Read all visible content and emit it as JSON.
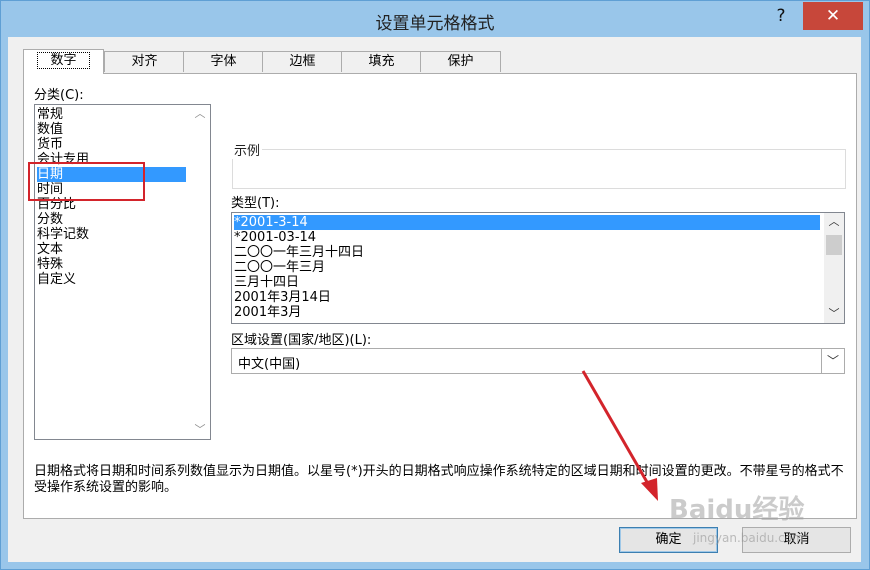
{
  "window": {
    "title": "设置单元格格式",
    "help_label": "?",
    "close_label": "✕"
  },
  "tabs": [
    "数字",
    "对齐",
    "字体",
    "边框",
    "填充",
    "保护"
  ],
  "category": {
    "label": "分类(C):",
    "items": [
      "常规",
      "数值",
      "货币",
      "会计专用",
      "日期",
      "时间",
      "百分比",
      "分数",
      "科学记数",
      "文本",
      "特殊",
      "自定义"
    ],
    "selected": "日期"
  },
  "sample": {
    "label": "示例",
    "value": ""
  },
  "type": {
    "label": "类型(T):",
    "items": [
      "*2001-3-14",
      "*2001-03-14",
      "二〇〇一年三月十四日",
      "二〇〇一年三月",
      "三月十四日",
      "2001年3月14日",
      "2001年3月"
    ],
    "selected": "*2001-3-14"
  },
  "locale": {
    "label": "区域设置(国家/地区)(L):",
    "value": "中文(中国)"
  },
  "description": "日期格式将日期和时间系列数值显示为日期值。以星号(*)开头的日期格式响应操作系统特定的区域日期和时间设置的更改。不带星号的格式不受操作系统设置的影响。",
  "buttons": {
    "ok": "确定",
    "cancel": "取消"
  },
  "watermark": {
    "brand": "Baidu经验",
    "url": "jingyan.baidu.com"
  },
  "colors": {
    "selection": "#3399ff",
    "annotation": "#d3242b",
    "titlebar": "#99c6ea",
    "close": "#c7473a"
  }
}
